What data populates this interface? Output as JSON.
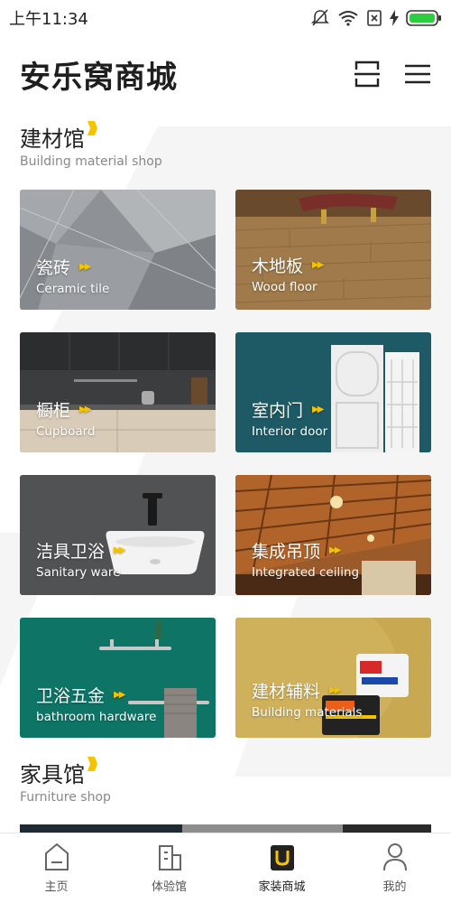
{
  "status_bar": {
    "time": "上午11:34"
  },
  "header": {
    "title": "安乐窝商城",
    "scan_icon": "scan-icon",
    "menu_icon": "menu-icon"
  },
  "building_section": {
    "title": "建材馆",
    "subtitle": "Building material shop",
    "tiles": [
      {
        "cn": "瓷砖",
        "en": "Ceramic tile"
      },
      {
        "cn": "木地板",
        "en": "Wood floor"
      },
      {
        "cn": "橱柜",
        "en": "Cupboard"
      },
      {
        "cn": "室内门",
        "en": "Interior door"
      },
      {
        "cn": "洁具卫浴",
        "en": "Sanitary ware"
      },
      {
        "cn": "集成吊顶",
        "en": "Integrated ceiling"
      },
      {
        "cn": "卫浴五金",
        "en": "bathroom hardware"
      },
      {
        "cn": "建材辅料",
        "en": "Building materials"
      }
    ]
  },
  "furniture_section": {
    "title": "家具馆",
    "subtitle": "Furniture shop"
  },
  "bottom_nav": {
    "items": [
      {
        "label": "主页",
        "icon": "home-icon"
      },
      {
        "label": "体验馆",
        "icon": "building-icon"
      },
      {
        "label": "家装商城",
        "icon": "mall-icon"
      },
      {
        "label": "我的",
        "icon": "person-icon"
      }
    ],
    "active_index": 2
  },
  "colors": {
    "accent": "#f5c400",
    "text": "#222222",
    "subtext": "#888888"
  }
}
